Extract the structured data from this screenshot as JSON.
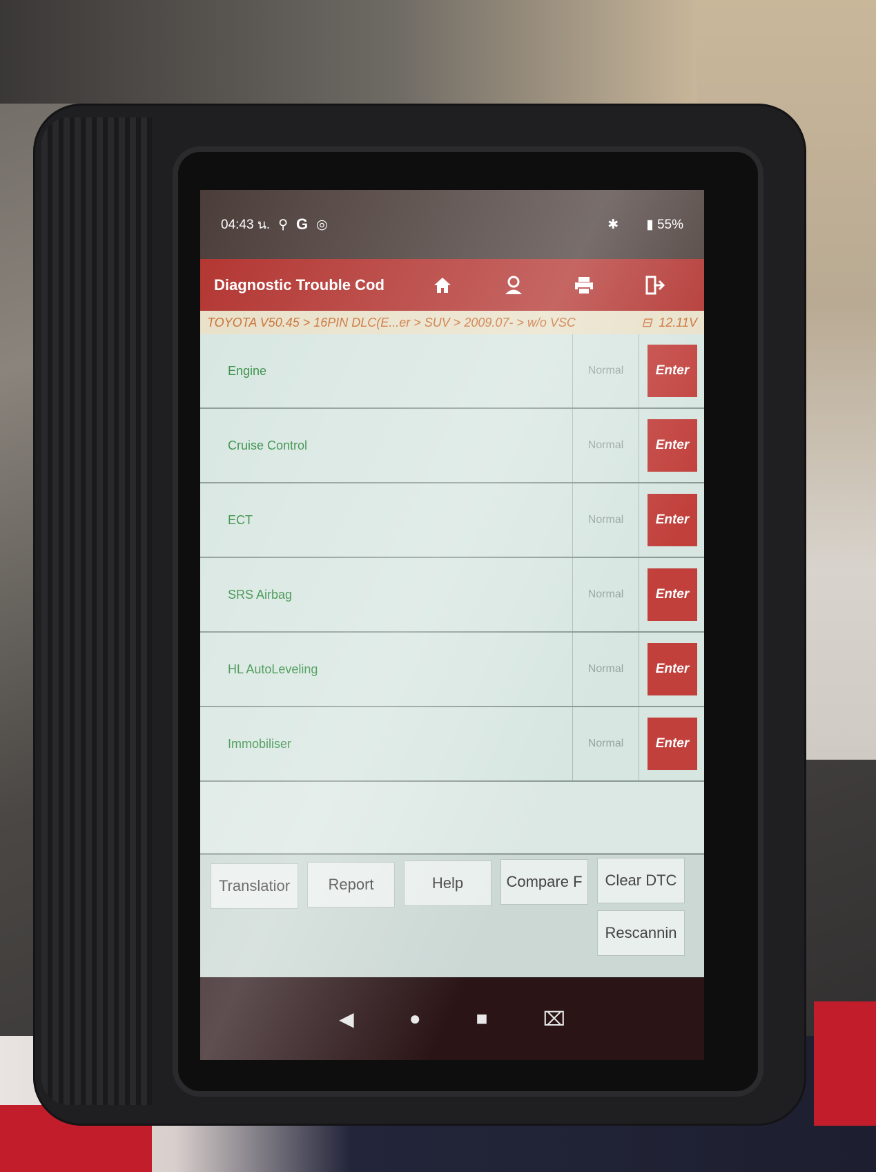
{
  "status_bar": {
    "time": "04:43 น.",
    "icons_left": [
      "usb-icon",
      "google-icon",
      "clock-app-icon"
    ],
    "battery": "55%",
    "icons_right": [
      "bluetooth-icon",
      "battery-icon"
    ]
  },
  "app_bar": {
    "title": "Diagnostic Trouble Cod",
    "icons": [
      "home-icon",
      "user-icon",
      "print-icon",
      "exit-icon"
    ]
  },
  "breadcrumb": {
    "path": "TOYOTA V50.45 > 16PIN DLC(E...er > SUV > 2009.07- > w/o VSC",
    "voltage": "12.11V"
  },
  "systems": [
    {
      "name": "Engine",
      "status": "Normal",
      "action": "Enter"
    },
    {
      "name": "Cruise Control",
      "status": "Normal",
      "action": "Enter"
    },
    {
      "name": "ECT",
      "status": "Normal",
      "action": "Enter"
    },
    {
      "name": "SRS Airbag",
      "status": "Normal",
      "action": "Enter"
    },
    {
      "name": "HL AutoLeveling",
      "status": "Normal",
      "action": "Enter"
    },
    {
      "name": "Immobiliser",
      "status": "Normal",
      "action": "Enter"
    }
  ],
  "buttons": {
    "translation": "Translatior",
    "report": "Report",
    "help": "Help",
    "compare": "Compare F",
    "clear_dtc": "Clear DTC",
    "rescan": "Rescannin"
  },
  "colors": {
    "accent": "#b2332f",
    "enter_button": "#c1403c",
    "system_name": "#2e8a3e",
    "breadcrumb": "#c86b2e"
  }
}
